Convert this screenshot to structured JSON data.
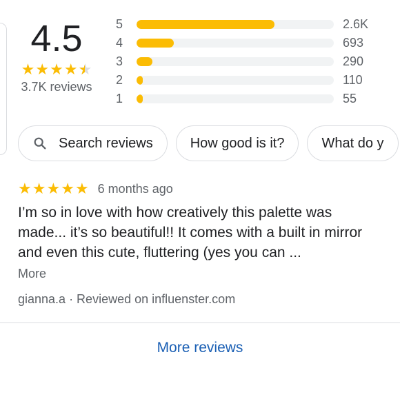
{
  "summary": {
    "average": "4.5",
    "rating_value": 4.5,
    "review_count": "3.7K reviews"
  },
  "distribution": [
    {
      "stars": "5",
      "count": "2.6K",
      "fraction": 0.7
    },
    {
      "stars": "4",
      "count": "693",
      "fraction": 0.19
    },
    {
      "stars": "3",
      "count": "290",
      "fraction": 0.08
    },
    {
      "stars": "2",
      "count": "110",
      "fraction": 0.03
    },
    {
      "stars": "1",
      "count": "55",
      "fraction": 0.02
    }
  ],
  "chips": {
    "search": "Search reviews",
    "question1": "How good is it?",
    "question2": "What do y"
  },
  "review": {
    "rating": 5,
    "date": "6 months ago",
    "text": "I’m so in love with how creatively this palette was made... it’s so beautiful!! It comes with a built in mirror and even this cute, fluttering (yes you can ...",
    "more": "More",
    "author": "gianna.a · Reviewed on influenster.com"
  },
  "footer": {
    "more_reviews": "More reviews"
  },
  "colors": {
    "star": "#fbbc04",
    "link": "#1a5fb4",
    "track": "#f1f3f4"
  }
}
